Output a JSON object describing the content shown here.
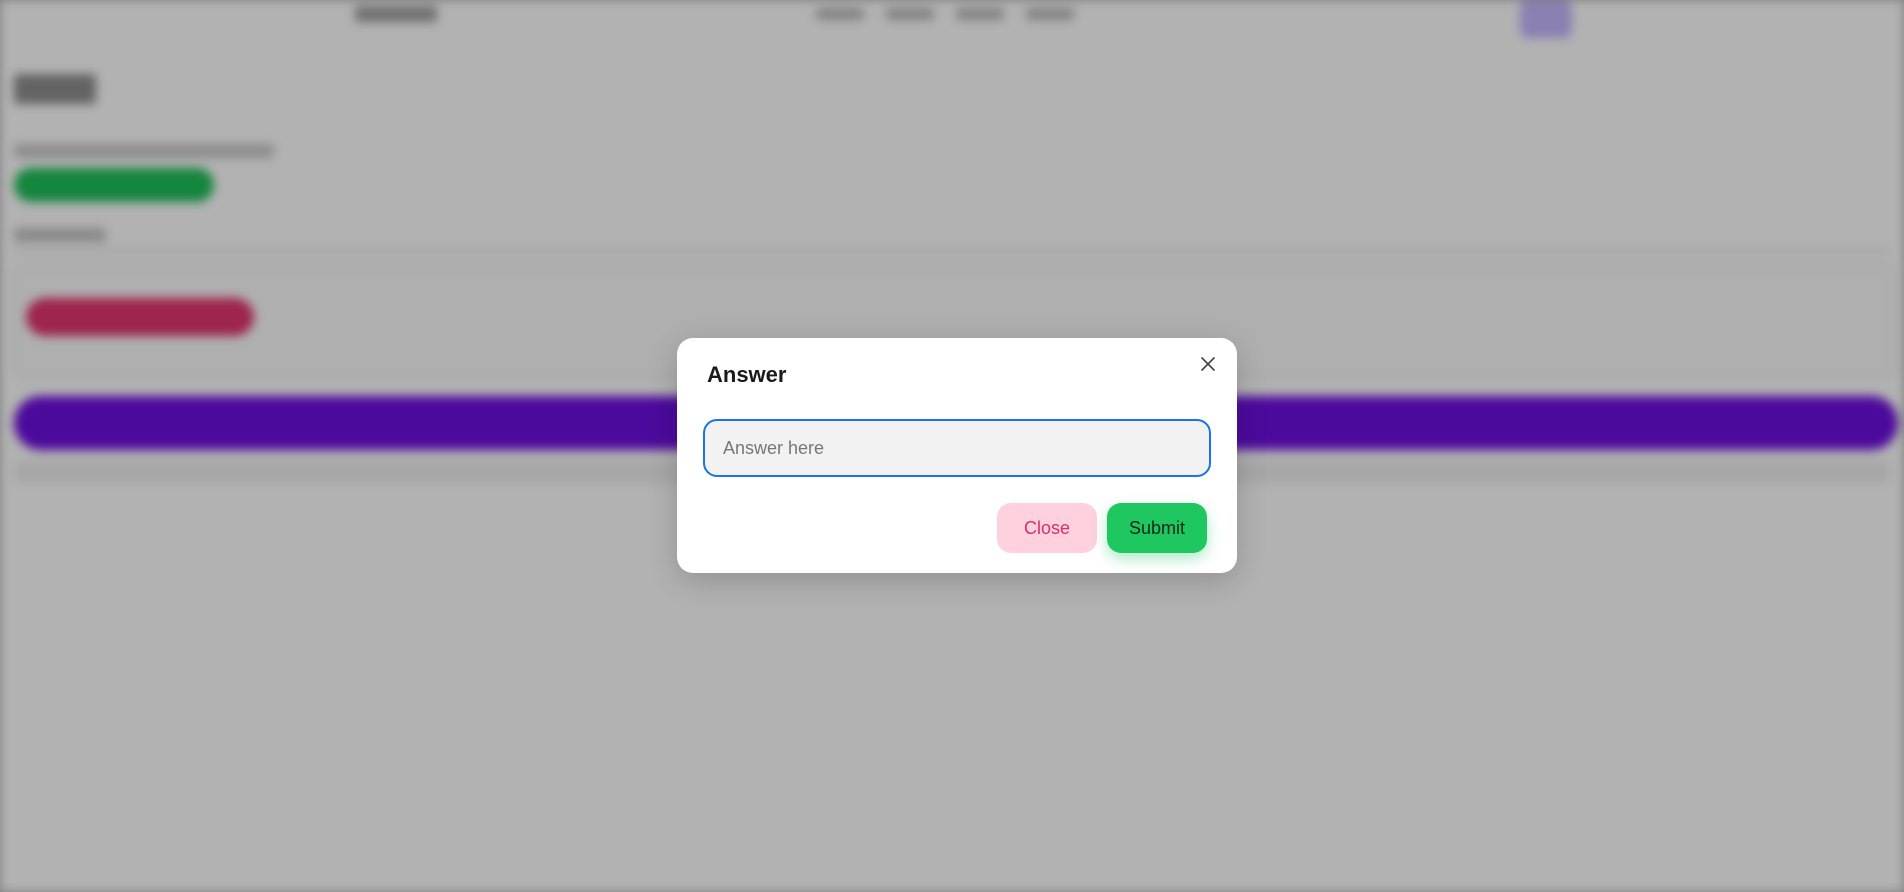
{
  "modal": {
    "title": "Answer",
    "input_placeholder": "Answer here",
    "input_value": "",
    "close_label": "Close",
    "submit_label": "Submit",
    "close_icon": "close-icon"
  },
  "colors": {
    "input_focus_border": "#1a73e8",
    "close_button_bg": "#ffd1de",
    "close_button_text": "#d72f6b",
    "submit_button_bg": "#1ec75f",
    "background_green_pill": "#1fc05a",
    "background_pink_pill": "#e2356f",
    "background_purple_bar": "#6e0fe0"
  }
}
